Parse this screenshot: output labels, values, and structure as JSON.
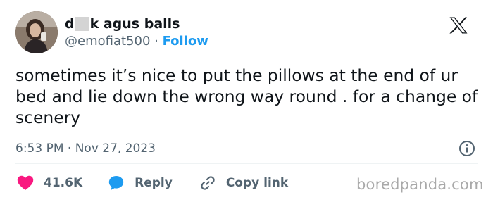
{
  "user": {
    "name_first": "d",
    "name_rest": "k agus balls",
    "handle": "@emofiat500",
    "separator": " · ",
    "follow_label": "Follow"
  },
  "tweet": {
    "text": "sometimes it’s nice to put the pillows at the end of ur bed and lie down the wrong way round . for a change of scenery",
    "timestamp": "6:53 PM · Nov 27, 2023"
  },
  "actions": {
    "likes": "41.6K",
    "reply": "Reply",
    "copy_link": "Copy link"
  },
  "icons": {
    "heart": "heart-icon",
    "reply": "reply-bubble-icon",
    "link": "link-icon",
    "info": "info-icon",
    "brand": "x-logo-icon"
  },
  "colors": {
    "heart": "#f91880",
    "reply": "#1d9bf0",
    "link": "#1d9bf0",
    "follow": "#1d9bf0",
    "muted": "#536471",
    "watermark": "#a9a9a9"
  },
  "watermark": "boredpanda.com"
}
